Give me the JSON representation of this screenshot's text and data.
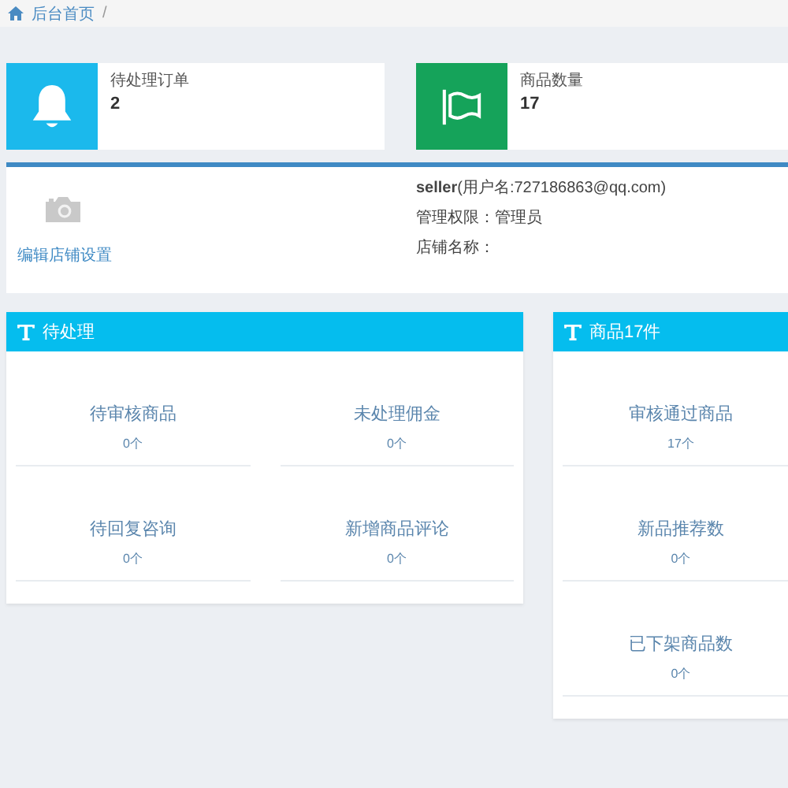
{
  "breadcrumb": {
    "items": [
      "后台首页"
    ],
    "separator": "/"
  },
  "stat_cards": [
    {
      "kind": "bell",
      "label": "待处理订单",
      "value": "2",
      "color": "#1bb9ec"
    },
    {
      "kind": "flag",
      "label": "商品数量",
      "value": "17",
      "color": "#15a35a"
    }
  ],
  "store_info": {
    "edit_link": "编辑店铺设置",
    "username": "seller",
    "account": "(用户名:727186863@qq.com)",
    "role": "管理权限：管理员",
    "store_name": "店铺名称："
  },
  "panels": [
    {
      "title": "待处理",
      "kind": "grid",
      "items": [
        {
          "label": "待审核商品",
          "count": "0个"
        },
        {
          "label": "未处理佣金",
          "count": "0个"
        },
        {
          "label": "待回复咨询",
          "count": "0个"
        },
        {
          "label": "新增商品评论",
          "count": "0个"
        }
      ]
    },
    {
      "title": "商品17件",
      "kind": "list",
      "items": [
        {
          "label": "审核通过商品",
          "count": "17个"
        },
        {
          "label": "新品推荐数",
          "count": "0个"
        },
        {
          "label": "已下架商品数",
          "count": "0个"
        }
      ]
    }
  ]
}
